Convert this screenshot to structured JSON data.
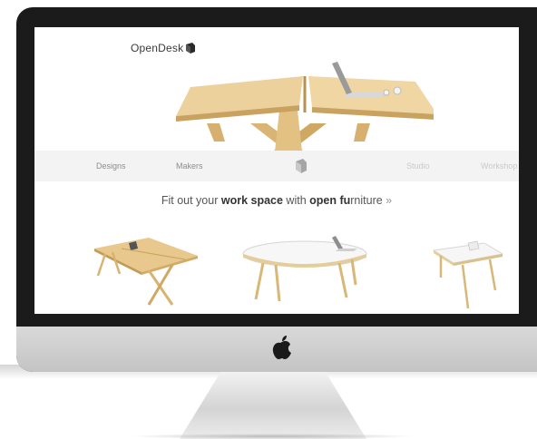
{
  "screen": {
    "logo_text": "OpenDesk",
    "nav": {
      "designs": "Designs",
      "makers": "Makers",
      "studio": "Studio",
      "workshop": "Workshop"
    },
    "tagline": {
      "t1": "Fit out your ",
      "t2": "work space",
      "t3": " with ",
      "t4": "open fu",
      "t5": "rniture",
      "t6": " »"
    }
  },
  "colors": {
    "wood": "#e6c58a",
    "bezel": "#1b1b1b",
    "nav_bg": "#f3f3f3"
  },
  "icons": [
    "opendesk-logo-icon",
    "opendesk-nav-icon",
    "apple-logo-icon"
  ]
}
